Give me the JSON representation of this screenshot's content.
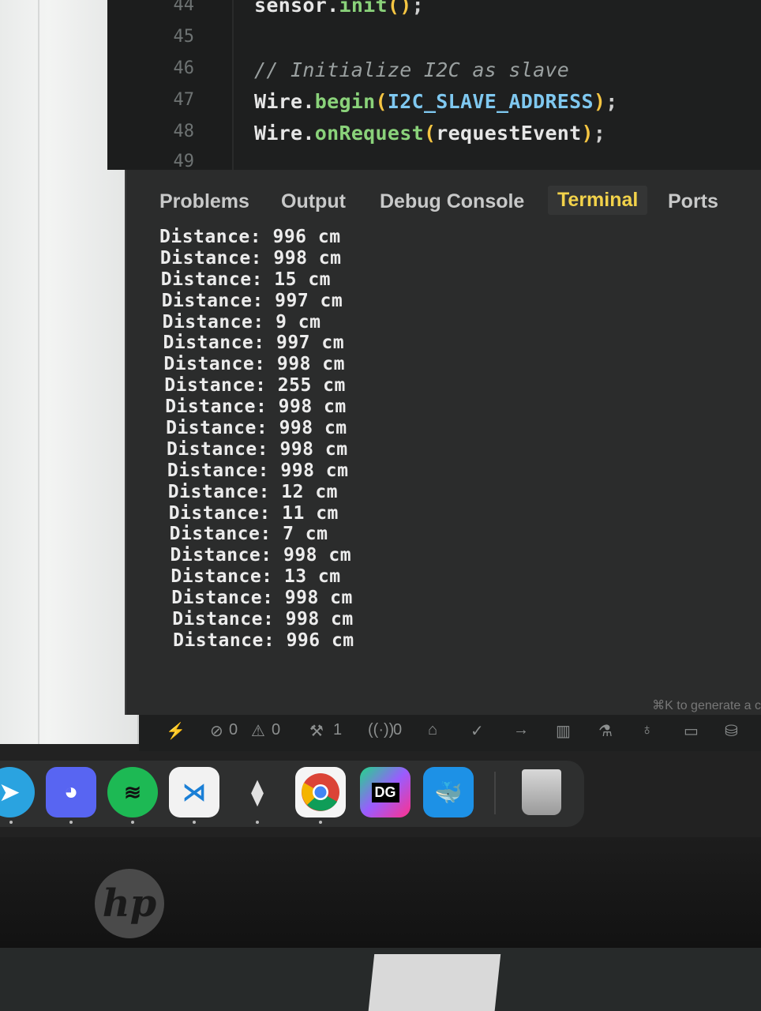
{
  "editor": {
    "lines": [
      {
        "num": "44",
        "code": "sensor.init();"
      },
      {
        "num": "45",
        "code": ""
      },
      {
        "num": "46",
        "code": "// Initialize I2C as slave"
      },
      {
        "num": "47",
        "code": "Wire.begin(I2C_SLAVE_ADDRESS);"
      },
      {
        "num": "48",
        "code": "Wire.onRequest(requestEvent);"
      },
      {
        "num": "49",
        "code": ""
      }
    ]
  },
  "panel": {
    "tabs": [
      "Problems",
      "Output",
      "Debug Console",
      "Terminal",
      "Ports"
    ],
    "active_tab": "Terminal",
    "terminal_lines": [
      "Distance: 996 cm",
      "Distance: 998 cm",
      "Distance: 15 cm",
      "Distance: 997 cm",
      "Distance: 9 cm",
      "Distance: 997 cm",
      "Distance: 998 cm",
      "Distance: 255 cm",
      "Distance: 998 cm",
      "Distance: 998 cm",
      "Distance: 998 cm",
      "Distance: 998 cm",
      "Distance: 12 cm",
      "Distance: 11 cm",
      "Distance: 7 cm",
      "Distance: 998 cm",
      "Distance: 13 cm",
      "Distance: 998 cm",
      "Distance: 998 cm",
      "Distance: 996 cm"
    ],
    "hint": "⌘K to generate a c"
  },
  "statusbar": {
    "errors": "0",
    "warnings": "0",
    "tools": "1",
    "ports": "0"
  },
  "dock": {
    "apps": [
      "telegram-icon",
      "discord-icon",
      "spotify-icon",
      "vscode-icon",
      "sublime-icon",
      "chrome-icon",
      "datagrip-icon",
      "docker-icon",
      "trash-icon"
    ],
    "datagrip_label": "DG"
  },
  "monitor": {
    "brand": "hp"
  },
  "colors": {
    "active_tab": "#f2d24a",
    "function": "#8ad27a",
    "constant": "#7fc8f0"
  }
}
